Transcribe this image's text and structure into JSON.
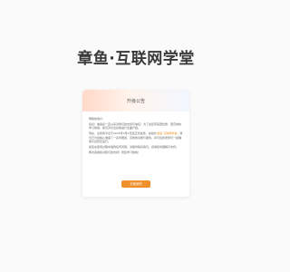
{
  "brand": {
    "title": "章鱼·互联网学堂"
  },
  "notice": {
    "title": "升级公告",
    "greeting": "尊敬的用户：",
    "para1": "您好！章鱼初一直以来对我们的支持与信任！为了给您带来更优质、更高效的学习体验，我们对平台系统进行全面升级。",
    "para2_before": "现在，全新的平台于2025年3月9日起正式启用。在新的 ",
    "para2_highlight": "章鱼·互联网学堂",
    "para2_after": "，我们已为您精心准备了一系列便捷、高效的功能与服务，并与您的老师们一起确保平台稳定运行。",
    "para3": "如您在使用过程中遇到任何问题，请随时联系我们，感谢您的理解与支持。",
    "para4": "再次感谢您对我们的支持！祝您学习愉快！",
    "button_label": "去使用吧"
  }
}
